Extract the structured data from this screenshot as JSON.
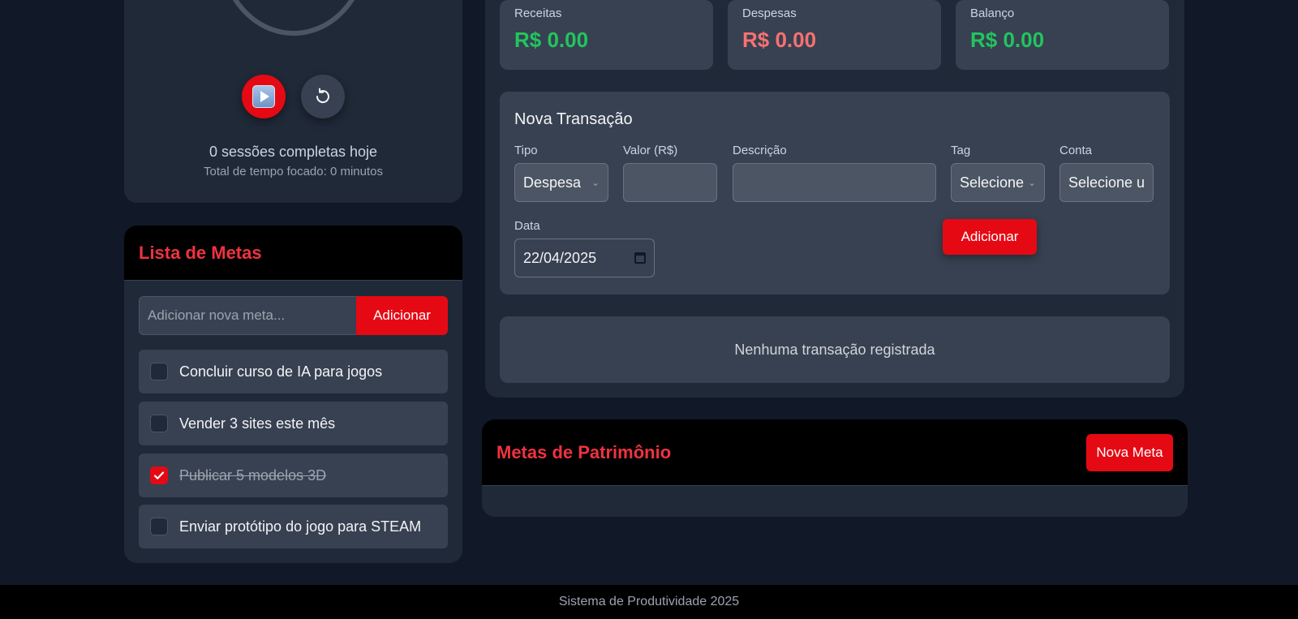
{
  "pomodoro": {
    "sessions_text": "0 sessões completas hoje",
    "focus_text": "Total de tempo focado: 0 minutos",
    "play_icon": "play-icon",
    "reset_icon": "reset-icon"
  },
  "goals": {
    "title": "Lista de Metas",
    "input_placeholder": "Adicionar nova meta...",
    "add_label": "Adicionar",
    "items": [
      {
        "text": "Concluir curso de IA para jogos",
        "done": false
      },
      {
        "text": "Vender 3 sites este mês",
        "done": false
      },
      {
        "text": "Publicar 5 modelos 3D",
        "done": true
      },
      {
        "text": "Enviar protótipo do jogo para STEAM",
        "done": false
      }
    ]
  },
  "finance": {
    "stats": [
      {
        "label": "Receitas",
        "value": "R$ 0.00",
        "color": "#22c55e"
      },
      {
        "label": "Despesas",
        "value": "R$ 0.00",
        "color": "#f87171"
      },
      {
        "label": "Balanço",
        "value": "R$ 0.00",
        "color": "#22c55e"
      }
    ],
    "form": {
      "title": "Nova Transação",
      "tipo_label": "Tipo",
      "tipo_value": "Despesa",
      "valor_label": "Valor (R$)",
      "valor_value": "",
      "descricao_label": "Descrição",
      "descricao_value": "",
      "tag_label": "Tag",
      "tag_value": "Selecione",
      "conta_label": "Conta",
      "conta_value": "Selecione u",
      "data_label": "Data",
      "data_value": "22/04/2025",
      "add_label": "Adicionar"
    },
    "empty_text": "Nenhuma transação registrada"
  },
  "wealth": {
    "title": "Metas de Patrimônio",
    "new_goal_label": "Nova Meta"
  },
  "footer": {
    "text": "Sistema de Produtividade 2025"
  },
  "colors": {
    "accent": "#e50914",
    "heading_red": "#ef3340",
    "background": "#111827",
    "card": "#1f2937",
    "panel": "#374151"
  }
}
